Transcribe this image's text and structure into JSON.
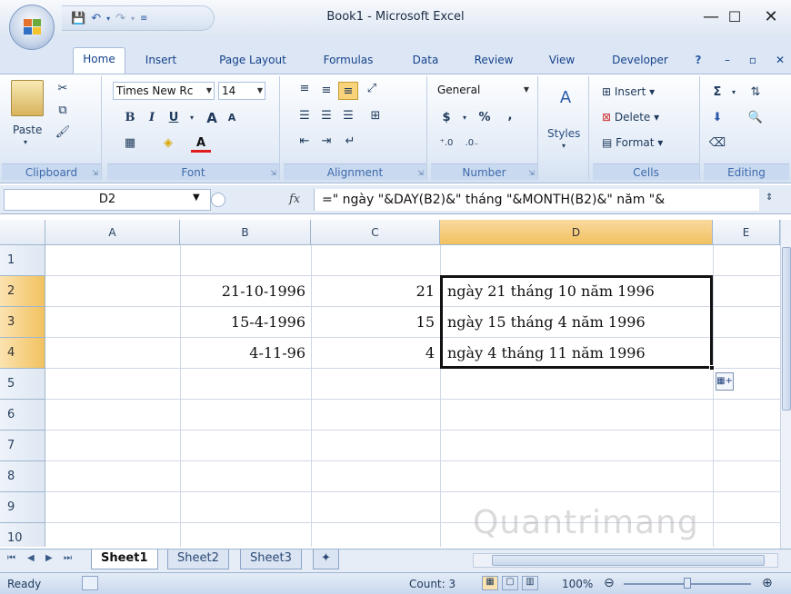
{
  "window": {
    "title": "Book1 - Microsoft Excel",
    "minimize_glyph": "—",
    "maximize_glyph": "☐",
    "close_glyph": "✕"
  },
  "ribbon_tabs": [
    "Home",
    "Insert",
    "Page Layout",
    "Formulas",
    "Data",
    "Review",
    "View",
    "Developer"
  ],
  "ribbon": {
    "clipboard": {
      "label": "Clipboard",
      "paste": "Paste"
    },
    "font": {
      "label": "Font",
      "name": "Times New Rc",
      "size": "14",
      "bold": "B",
      "italic": "I",
      "underline": "U",
      "grow": "A",
      "shrink": "A"
    },
    "alignment": {
      "label": "Alignment"
    },
    "number": {
      "label": "Number",
      "format": "General",
      "currency": "$",
      "percent": "%",
      "comma": ","
    },
    "styles": {
      "label": "Styles"
    },
    "cells": {
      "label": "Cells",
      "insert": "Insert",
      "delete": "Delete",
      "format": "Format"
    },
    "editing": {
      "label": "Editing"
    }
  },
  "formula_bar": {
    "name_box": "D2",
    "fx": "fx",
    "formula": "=\" ngày \"&DAY(B2)&\" tháng \"&MONTH(B2)&\" năm \"&"
  },
  "columns": [
    "A",
    "B",
    "C",
    "D",
    "E"
  ],
  "selected_column": "D",
  "rows": [
    "1",
    "2",
    "3",
    "4",
    "5",
    "6",
    "7",
    "8",
    "9",
    "10"
  ],
  "selected_rows": [
    "2",
    "3",
    "4"
  ],
  "cells": {
    "B2": "21-10-1996",
    "C2": "21",
    "D2": "ngày 21 tháng 10 năm 1996",
    "B3": "15-4-1996",
    "C3": "15",
    "D3": "ngày 15 tháng 4 năm 1996",
    "B4": "4-11-96",
    "C4": "4",
    "D4": "ngày 4 tháng 11 năm 1996"
  },
  "sheet_tabs": [
    "Sheet1",
    "Sheet2",
    "Sheet3"
  ],
  "active_sheet": "Sheet1",
  "status": {
    "ready": "Ready",
    "count": "Count: 3",
    "zoom": "100%"
  },
  "watermark": "Quantrimang",
  "colors": {
    "accent": "#1e395b",
    "selection_header": "#f1c15f",
    "ribbon_bg": "#dce6f4"
  }
}
